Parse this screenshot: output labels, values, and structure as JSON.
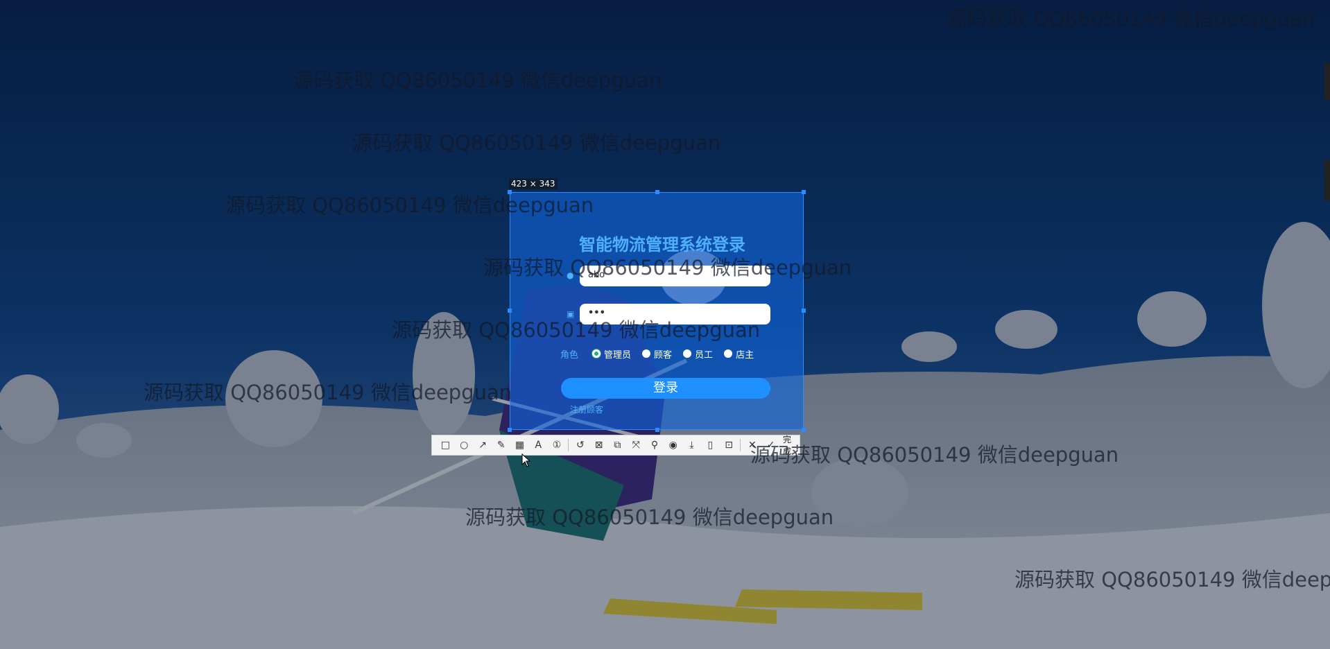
{
  "screenshot": {
    "size_badge": "423 × 343",
    "watermark_text": "源码获取 QQ86050149 微信deepguan"
  },
  "login": {
    "title": "智能物流管理系统登录",
    "username_value": "abo",
    "password_value": "•••",
    "role_label": "角色",
    "roles": [
      "管理员",
      "顾客",
      "员工",
      "店主"
    ],
    "selected_role": "管理员",
    "login_button": "登录",
    "register_link": "注册顾客"
  },
  "toolbar": {
    "tools": [
      "rectangle-icon",
      "ellipse-icon",
      "arrow-icon",
      "pen-icon",
      "mosaic-icon",
      "text-icon",
      "number-icon",
      "undo-icon",
      "ocr-icon",
      "translate-icon",
      "scroll-capture-icon",
      "pin-icon",
      "record-icon",
      "download-icon",
      "long-screenshot-icon",
      "bookmark-icon",
      "close-icon"
    ],
    "done_label": "完成"
  },
  "colors": {
    "accent": "#1e90ff",
    "selection": "#2a8cff",
    "title": "#4fb0ff"
  }
}
